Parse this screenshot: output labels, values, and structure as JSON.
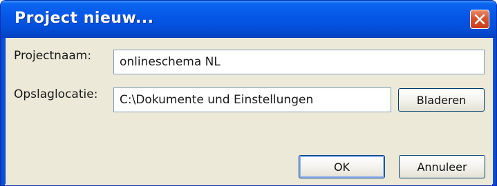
{
  "window": {
    "title": "Project nieuw..."
  },
  "form": {
    "project_name_label": "Projectnaam:",
    "project_name_value": "onlineschema NL",
    "location_label": "Opslaglocatie:",
    "location_value": "C:\\Dokumente und Einstellungen",
    "browse_label": "Bladeren"
  },
  "buttons": {
    "ok_label": "OK",
    "cancel_label": "Annuleer"
  },
  "colors": {
    "titlebar": "#0556e6",
    "close_button": "#d9542c",
    "dialog_background": "#ece9d8"
  },
  "icons": {
    "close": "close-icon"
  }
}
